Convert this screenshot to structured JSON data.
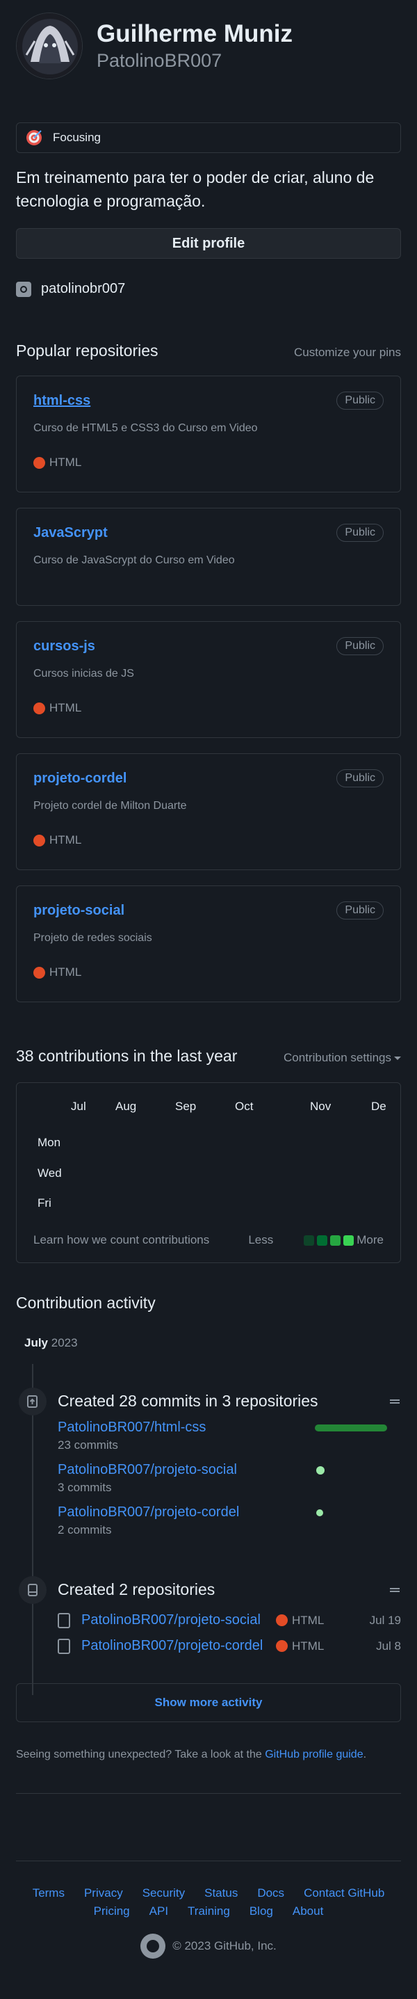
{
  "profile": {
    "fullname": "Guilherme Muniz",
    "login": "PatolinoBR007",
    "status": "Focusing",
    "status_icon": "dart-icon",
    "bio": "Em treinamento para ter o poder de criar, aluno de tecnologia e programação.",
    "edit_label": "Edit profile",
    "social": "patolinobr007"
  },
  "pinned": {
    "title": "Popular repositories",
    "customize": "Customize your pins",
    "repos": [
      {
        "name": "html-css",
        "visibility": "Public",
        "desc": "Curso de HTML5 e CSS3 do Curso em Video",
        "lang": "HTML"
      },
      {
        "name": "JavaScrypt",
        "visibility": "Public",
        "desc": "Curso de JavaScrypt do Curso em Video",
        "lang": ""
      },
      {
        "name": "cursos-js",
        "visibility": "Public",
        "desc": "Cursos inicias de JS",
        "lang": "HTML"
      },
      {
        "name": "projeto-cordel",
        "visibility": "Public",
        "desc": "Projeto cordel de Milton Duarte",
        "lang": "HTML"
      },
      {
        "name": "projeto-social",
        "visibility": "Public",
        "desc": "Projeto de redes sociais",
        "lang": "HTML"
      }
    ],
    "lang_color": "#e34c26"
  },
  "contributions": {
    "title": "38 contributions in the last year",
    "settings": "Contribution settings",
    "months": [
      "Jul",
      "Aug",
      "Sep",
      "Oct",
      "Nov",
      "De"
    ],
    "days": [
      "Mon",
      "Wed",
      "Fri"
    ],
    "learn": "Learn how we count contributions",
    "less": "Less",
    "more": "More",
    "legend_colors": [
      "#0e4429",
      "#006d32",
      "#26a641",
      "#39d353"
    ]
  },
  "activity": {
    "title": "Contribution activity",
    "month": "July",
    "year": "2023",
    "commits": {
      "title": "Created 28 commits in 3 repositories",
      "rows": [
        {
          "repo": "PatolinoBR007/html-css",
          "count": "23 commits"
        },
        {
          "repo": "PatolinoBR007/projeto-social",
          "count": "3 commits"
        },
        {
          "repo": "PatolinoBR007/projeto-cordel",
          "count": "2 commits"
        }
      ]
    },
    "created": {
      "title": "Created 2 repositories",
      "rows": [
        {
          "repo": "PatolinoBR007/projeto-social",
          "lang": "HTML",
          "date": "Jul 19"
        },
        {
          "repo": "PatolinoBR007/projeto-cordel",
          "lang": "HTML",
          "date": "Jul 8"
        }
      ]
    },
    "show_more": "Show more activity",
    "unexpected_prefix": "Seeing something unexpected? Take a look at the",
    "unexpected_link": "GitHub profile guide",
    "unexpected_suffix": "."
  },
  "footer": {
    "links": [
      "Terms",
      "Privacy",
      "Security",
      "Status",
      "Docs",
      "Contact GitHub",
      "Pricing",
      "API",
      "Training",
      "Blog",
      "About"
    ],
    "copyright": "© 2023 GitHub, Inc."
  }
}
